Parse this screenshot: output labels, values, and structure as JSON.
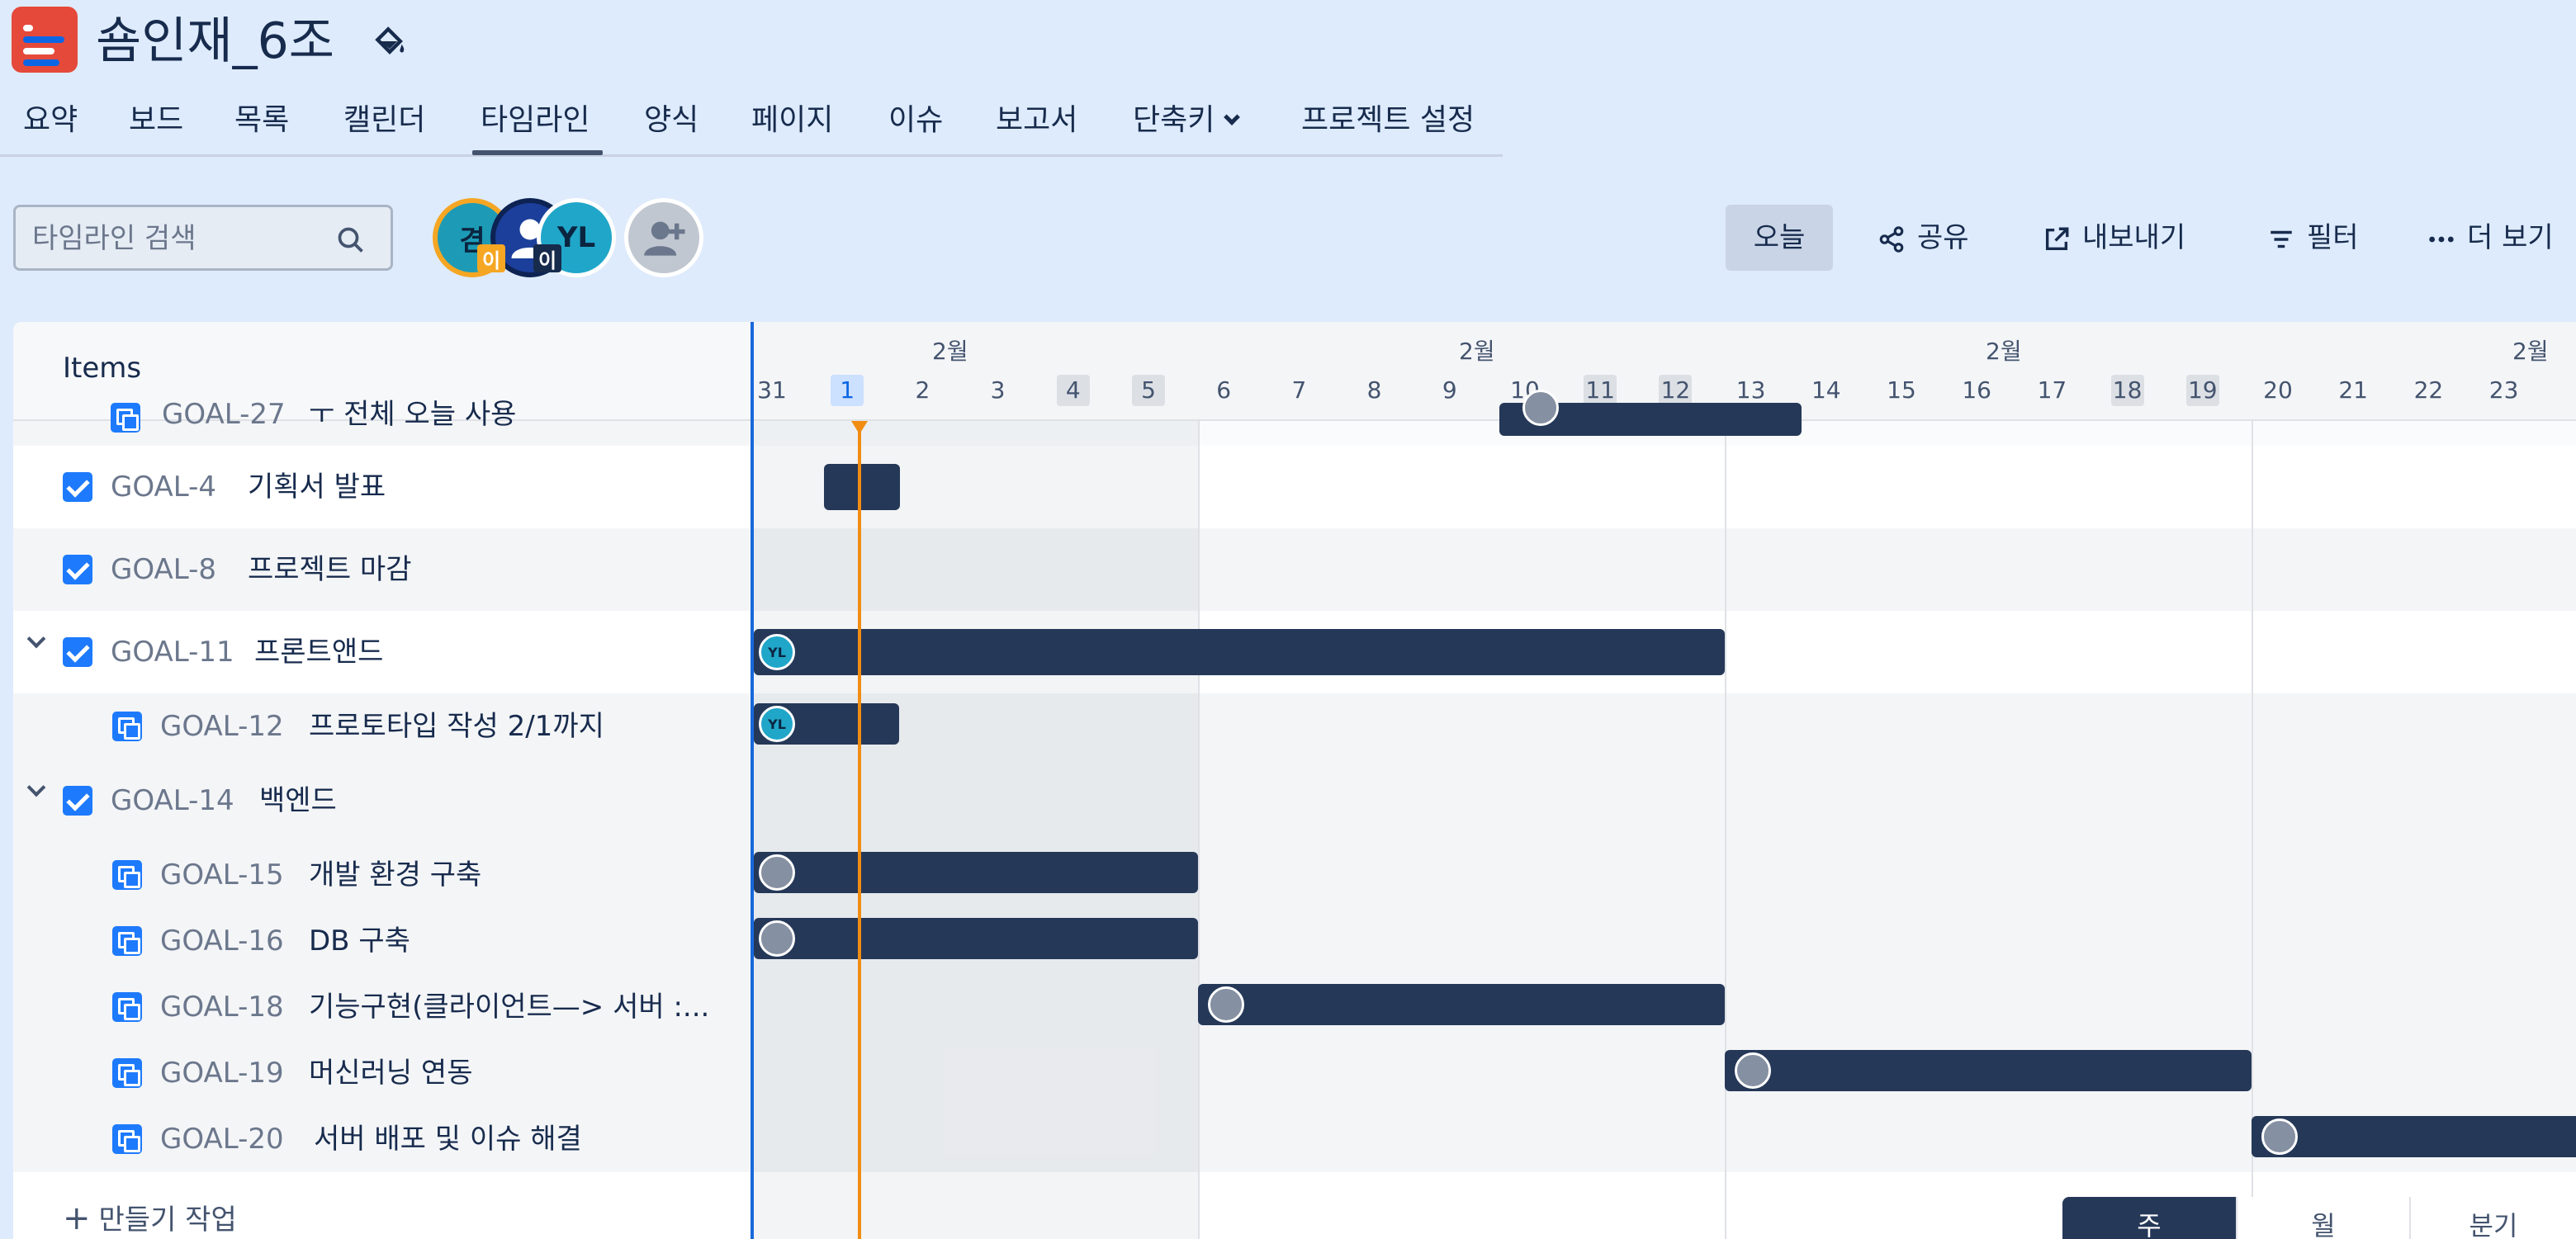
{
  "project": {
    "title": "숌인재_6조"
  },
  "nav": [
    {
      "label": "요약"
    },
    {
      "label": "보드"
    },
    {
      "label": "목록"
    },
    {
      "label": "캘린더"
    },
    {
      "label": "타임라인"
    },
    {
      "label": "양식"
    },
    {
      "label": "페이지"
    },
    {
      "label": "이슈"
    },
    {
      "label": "보고서"
    },
    {
      "label": "단축키"
    },
    {
      "label": "프로젝트 설정"
    }
  ],
  "toolbar": {
    "search_placeholder": "타임라인 검색",
    "avatars": [
      "겸",
      "YL"
    ],
    "avatar_badges": [
      "이",
      "이"
    ],
    "today": "오늘",
    "share": "공유",
    "export": "내보내기",
    "filter": "필터",
    "more": "더 보기"
  },
  "timeline": {
    "items_header": "Items",
    "months": [
      "2월",
      "2월",
      "2월",
      "2월"
    ],
    "days": [
      "31",
      "1",
      "2",
      "3",
      "4",
      "5",
      "6",
      "7",
      "8",
      "9",
      "10",
      "11",
      "12",
      "13",
      "14",
      "15",
      "16",
      "17",
      "18",
      "19",
      "20",
      "21",
      "22",
      "23"
    ],
    "rows": [
      {
        "key": "GOAL-27",
        "summary": "ㅜ 전체 오늘 사용"
      },
      {
        "key": "GOAL-4",
        "summary": "기획서 발표"
      },
      {
        "key": "GOAL-8",
        "summary": "프로젝트 마감"
      },
      {
        "key": "GOAL-11",
        "summary": "프론트앤드"
      },
      {
        "key": "GOAL-12",
        "summary": "프로토타입 작성 2/1까지"
      },
      {
        "key": "GOAL-14",
        "summary": "백엔드"
      },
      {
        "key": "GOAL-15",
        "summary": "개발 환경 구축"
      },
      {
        "key": "GOAL-16",
        "summary": "DB 구축"
      },
      {
        "key": "GOAL-18",
        "summary": "기능구현(클라이언트—> 서버 :..."
      },
      {
        "key": "GOAL-19",
        "summary": "머신러닝 연동"
      },
      {
        "key": "GOAL-20",
        "summary": "서버 배포 및 이슈 해결"
      }
    ],
    "bar_avatar_label": "YL",
    "create_label": "만들기 작업",
    "zoom": [
      "주",
      "월",
      "분기"
    ]
  }
}
